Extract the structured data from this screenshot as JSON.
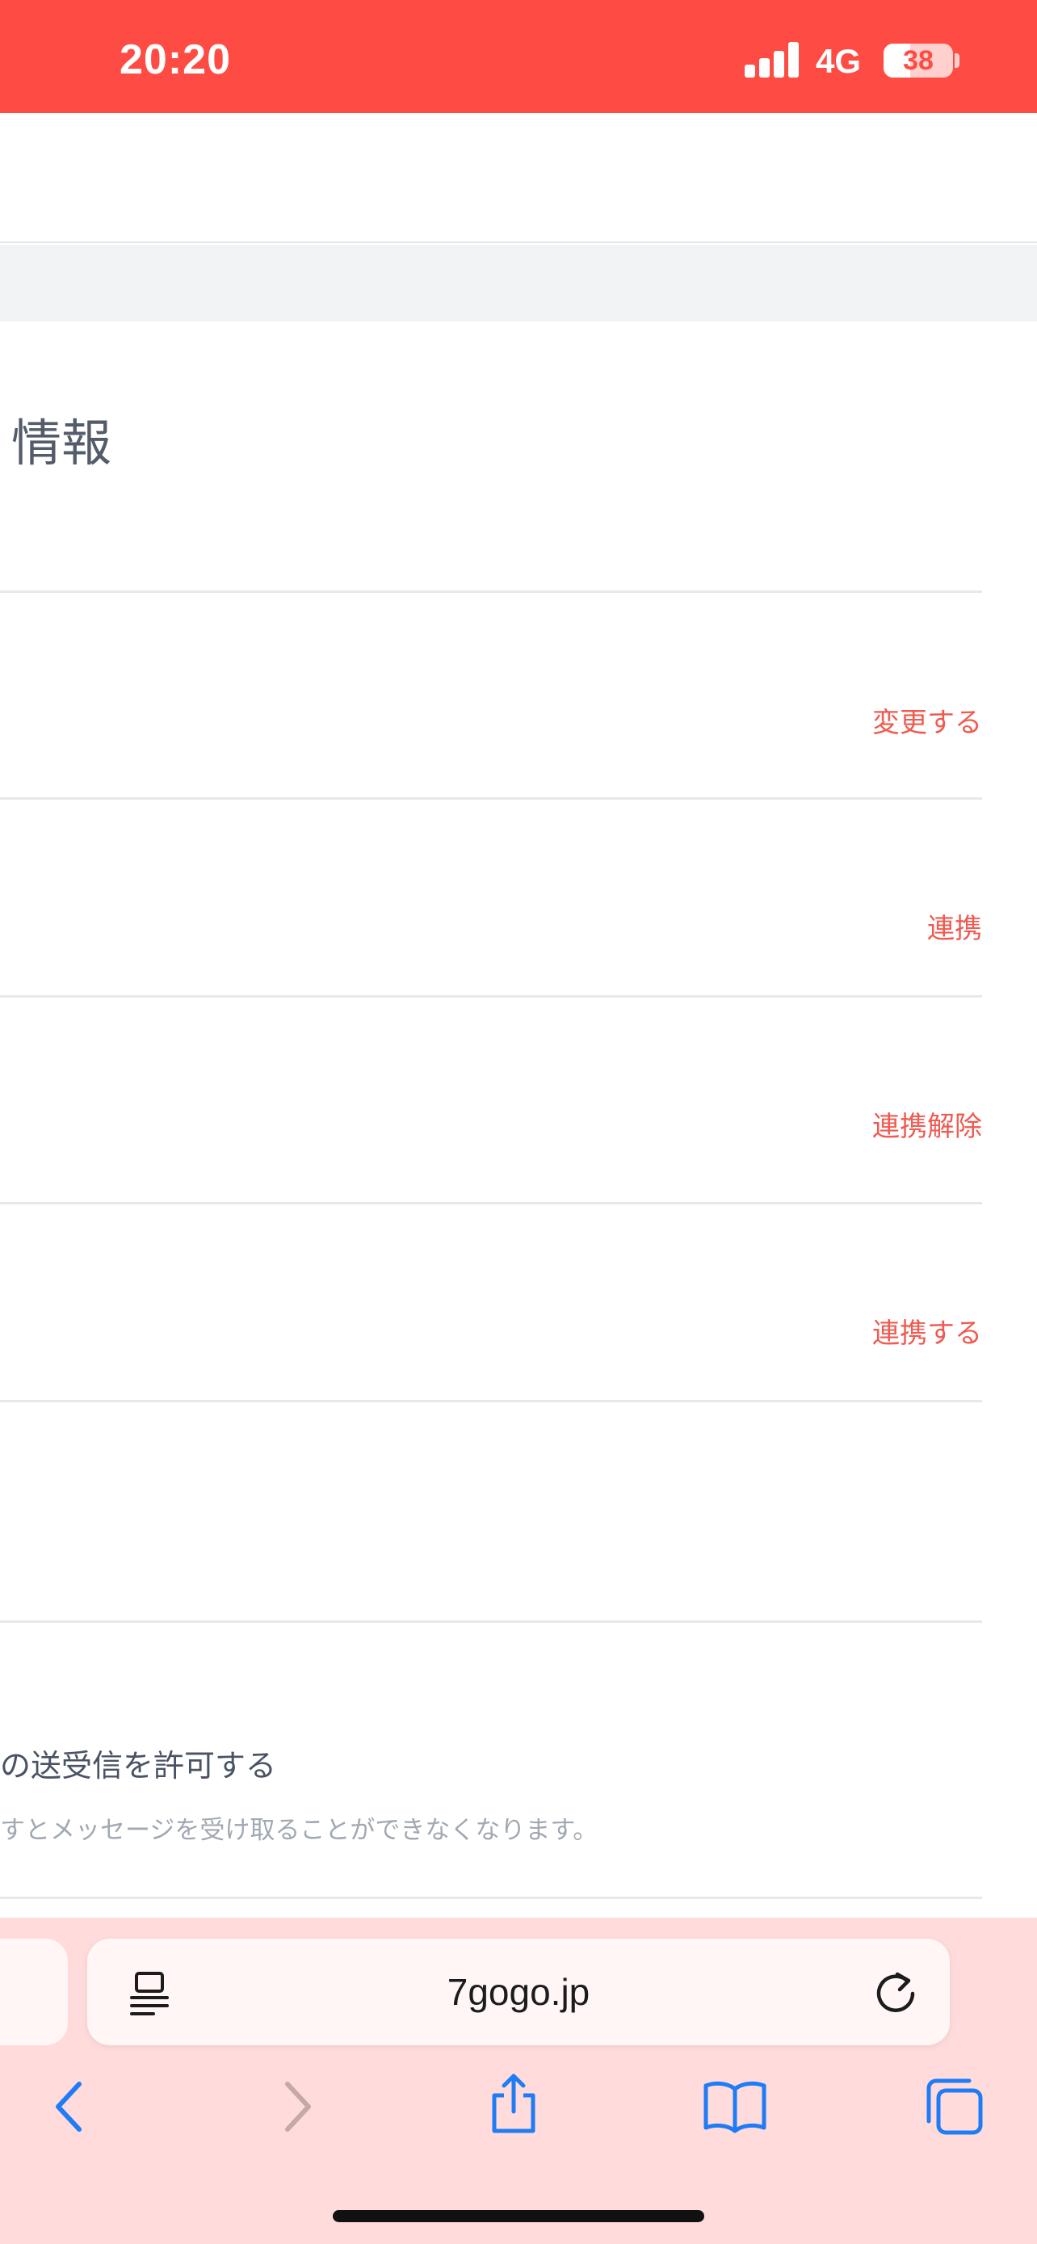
{
  "status_bar": {
    "time": "20:20",
    "network": "4G",
    "battery_percent": "38",
    "background_color": "#fe4c44"
  },
  "section": {
    "title": "情報"
  },
  "rows": [
    {
      "action_label": "変更する"
    },
    {
      "action_label": "連携"
    },
    {
      "action_label": "連携解除"
    },
    {
      "action_label": "連携する"
    }
  ],
  "message_setting": {
    "label": "の送受信を許可する",
    "note": "すとメッセージを受け取ることができなくなります。"
  },
  "browser": {
    "address": "7gogo.jp",
    "icons": {
      "reader": "page-format-icon",
      "reload": "reload-icon",
      "back": "back-arrow-icon",
      "forward": "forward-arrow-icon",
      "share": "share-icon",
      "bookmarks": "book-icon",
      "tabs": "tabs-icon"
    },
    "accent_color": "#1f7cf5",
    "background_color": "#ffdcdb"
  },
  "theme": {
    "action_color": "#f05a50",
    "divider_color": "#e6e8eb"
  }
}
